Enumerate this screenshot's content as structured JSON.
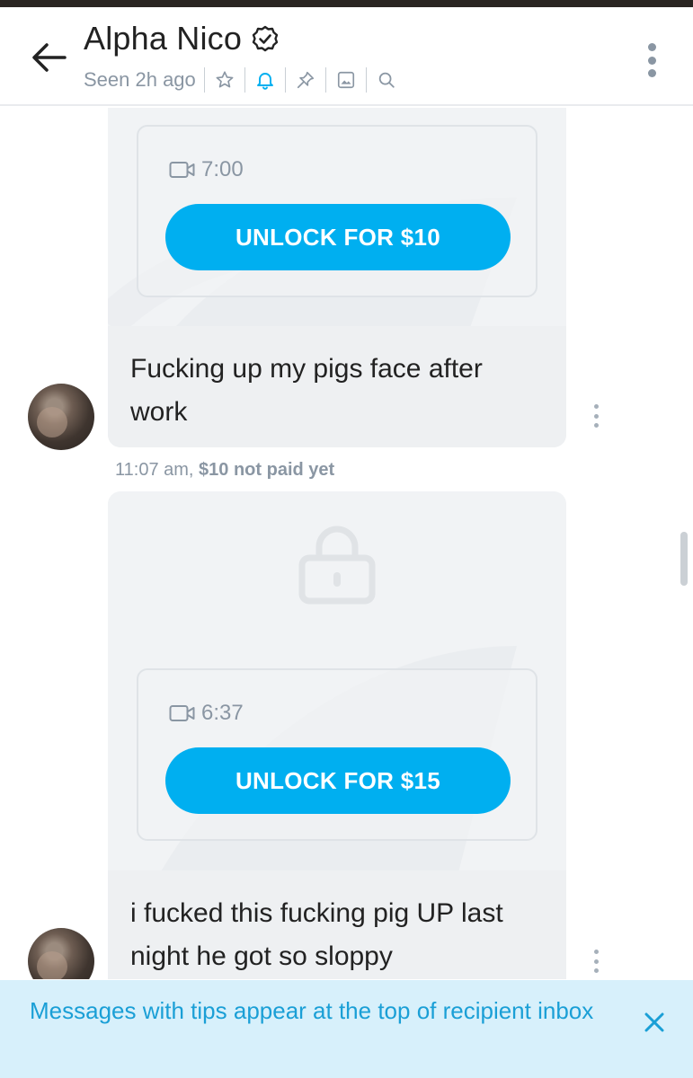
{
  "header": {
    "name": "Alpha Nico",
    "status": "Seen 2h ago",
    "icons": [
      "star-icon",
      "bell-icon",
      "pin-icon",
      "image-icon",
      "search-icon"
    ]
  },
  "messages": [
    {
      "media_duration": "7:00",
      "unlock_label": "UNLOCK FOR $10",
      "text": "Fucking up my pigs face after work",
      "time": "11:07 am,",
      "payment_status": "$10 not paid yet"
    },
    {
      "media_duration": "6:37",
      "unlock_label": "UNLOCK FOR $15",
      "text": "i fucked this fucking pig UP last night he got so sloppy"
    }
  ],
  "notice": {
    "text": "Messages with tips appear at the top of recipient inbox"
  },
  "colors": {
    "accent": "#00aff0",
    "notice_bg": "#d7f0fb",
    "notice_text": "#1a9fd6",
    "muted": "#8a96a3"
  }
}
